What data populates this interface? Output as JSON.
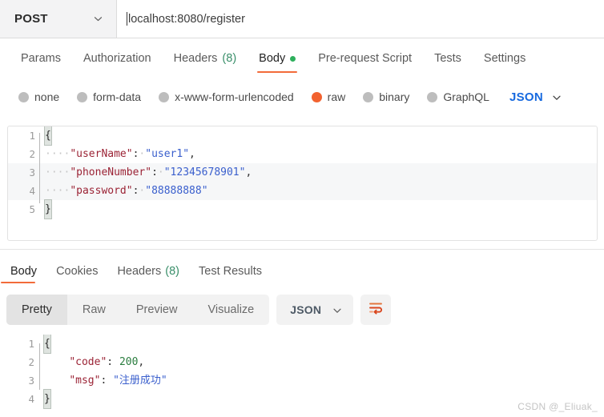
{
  "request_bar": {
    "method": "POST",
    "method_chevron_icon": "chevron-down-icon",
    "url": "localhost:8080/register",
    "url_placeholder": "Enter request URL"
  },
  "request_tabs": [
    {
      "label": "Params",
      "active": false,
      "badge": ""
    },
    {
      "label": "Authorization",
      "active": false,
      "badge": ""
    },
    {
      "label": "Headers",
      "active": false,
      "badge": "(8)"
    },
    {
      "label": "Body",
      "active": true,
      "badge": "",
      "dot": "green-dot-icon"
    },
    {
      "label": "Pre-request Script",
      "active": false,
      "badge": ""
    },
    {
      "label": "Tests",
      "active": false,
      "badge": ""
    },
    {
      "label": "Settings",
      "active": false,
      "badge": ""
    }
  ],
  "body_types": {
    "options": [
      {
        "label": "none",
        "selected": false
      },
      {
        "label": "form-data",
        "selected": false
      },
      {
        "label": "x-www-form-urlencoded",
        "selected": false
      },
      {
        "label": "raw",
        "selected": true
      },
      {
        "label": "binary",
        "selected": false
      },
      {
        "label": "GraphQL",
        "selected": false
      }
    ],
    "language": "JSON",
    "language_chevron_icon": "chevron-down-icon"
  },
  "request_body": {
    "lines": [
      {
        "num": "1",
        "brace": "{",
        "indent": "",
        "key": "",
        "colon": "",
        "value": "",
        "comma": "",
        "band": false
      },
      {
        "num": "2",
        "brace": "",
        "indent": "····",
        "key": "\"userName\"",
        "colon": ":",
        "value": "\"user1\"",
        "value_type": "string",
        "comma": ",",
        "band": false
      },
      {
        "num": "3",
        "brace": "",
        "indent": "····",
        "key": "\"phoneNumber\"",
        "colon": ":",
        "value": "\"12345678901\"",
        "value_type": "string",
        "comma": ",",
        "band": true
      },
      {
        "num": "4",
        "brace": "",
        "indent": "····",
        "key": "\"password\"",
        "colon": ":",
        "value": "\"88888888\"",
        "value_type": "string",
        "comma": "",
        "band": true
      },
      {
        "num": "5",
        "brace": "}",
        "indent": "",
        "key": "",
        "colon": "",
        "value": "",
        "comma": "",
        "band": false
      }
    ]
  },
  "response_tabs": [
    {
      "label": "Body",
      "active": true,
      "badge": ""
    },
    {
      "label": "Cookies",
      "active": false,
      "badge": ""
    },
    {
      "label": "Headers",
      "active": false,
      "badge": "(8)"
    },
    {
      "label": "Test Results",
      "active": false,
      "badge": ""
    }
  ],
  "response_toolbar": {
    "view_modes": [
      {
        "label": "Pretty",
        "active": true
      },
      {
        "label": "Raw",
        "active": false
      },
      {
        "label": "Preview",
        "active": false
      },
      {
        "label": "Visualize",
        "active": false
      }
    ],
    "format": "JSON",
    "format_chevron_icon": "chevron-down-icon",
    "wrap_button_icon": "word-wrap-icon"
  },
  "response_body": {
    "lines": [
      {
        "num": "1",
        "brace": "{",
        "indent": "",
        "key": "",
        "colon": "",
        "value": "",
        "comma": ""
      },
      {
        "num": "2",
        "brace": "",
        "indent": "    ",
        "key": "\"code\"",
        "colon": ":",
        "value": "200",
        "value_type": "number",
        "comma": ","
      },
      {
        "num": "3",
        "brace": "",
        "indent": "    ",
        "key": "\"msg\"",
        "colon": ":",
        "value": "\"注册成功\"",
        "value_type": "string",
        "comma": ""
      },
      {
        "num": "4",
        "brace": "}",
        "indent": "",
        "key": "",
        "colon": "",
        "value": "",
        "comma": ""
      }
    ]
  },
  "watermark": {
    "text": "CSDN @_Eliuak_"
  },
  "colors": {
    "accent_orange": "#f26b3a",
    "radio_selected": "#f2622f",
    "dot_green": "#2eaf5c",
    "badge_green": "#3a8f6a",
    "json_blue": "#1669df",
    "key_red": "#9b2335",
    "string_blue": "#3a5fcd",
    "number_green": "#2a7d3f"
  }
}
